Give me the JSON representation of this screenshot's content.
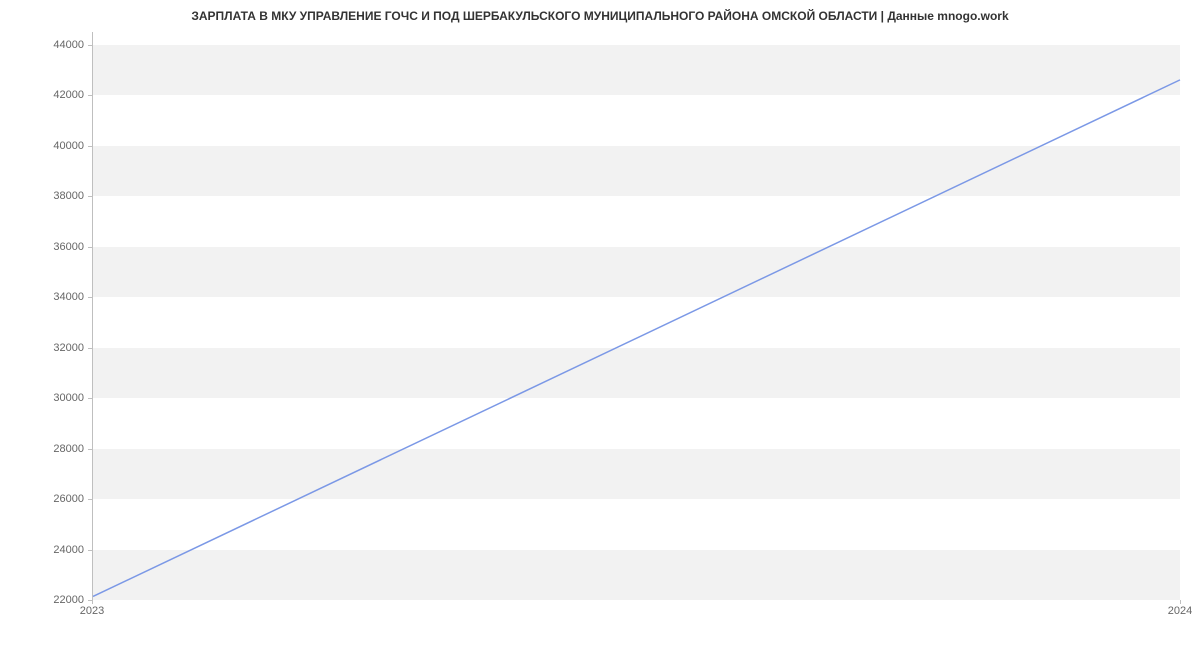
{
  "chart_data": {
    "type": "line",
    "title": "ЗАРПЛАТА В МКУ УПРАВЛЕНИЕ ГОЧС И ПОД ШЕРБАКУЛЬСКОГО МУНИЦИПАЛЬНОГО РАЙОНА ОМСКОЙ ОБЛАСТИ | Данные mnogo.work",
    "x": [
      2023,
      2024
    ],
    "values": [
      22100,
      42600
    ],
    "xlabel": "",
    "ylabel": "",
    "x_ticks": [
      2023,
      2024
    ],
    "y_ticks": [
      22000,
      24000,
      26000,
      28000,
      30000,
      32000,
      34000,
      36000,
      38000,
      40000,
      42000,
      44000
    ],
    "ylim": [
      22000,
      44500
    ],
    "xlim": [
      2023,
      2024
    ],
    "line_color": "#7b98e6"
  }
}
